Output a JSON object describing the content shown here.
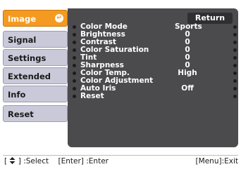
{
  "menu": {
    "tabs": [
      {
        "label": "Image",
        "active": true
      },
      {
        "label": "Signal",
        "active": false
      },
      {
        "label": "Settings",
        "active": false
      },
      {
        "label": "Extended",
        "active": false
      },
      {
        "label": "Info",
        "active": false
      },
      {
        "label": "Reset",
        "active": false
      }
    ],
    "enter_glyph": "↵"
  },
  "panel": {
    "return_label": "Return",
    "rows": [
      {
        "label": "Color Mode",
        "value": "Sports"
      },
      {
        "label": "Brightness",
        "value": "0"
      },
      {
        "label": "Contrast",
        "value": "0"
      },
      {
        "label": "Color Saturation",
        "value": "0"
      },
      {
        "label": "Tint",
        "value": "0"
      },
      {
        "label": "Sharpness",
        "value": "0"
      },
      {
        "label": "Color Temp.",
        "value": "High"
      },
      {
        "label": "Color Adjustment",
        "value": ""
      },
      {
        "label": "Auto Iris",
        "value": "Off"
      },
      {
        "label": "Reset",
        "value": ""
      }
    ]
  },
  "footer": {
    "select_hint_prefix": "[",
    "select_hint_suffix": "] :Select",
    "enter_hint": "[Enter] :Enter",
    "exit_hint": "[Menu]:Exit"
  },
  "colors": {
    "active_tab": "#f59a20",
    "inactive_tab": "#c9c9d9",
    "panel_bg": "#4b4b4e"
  }
}
